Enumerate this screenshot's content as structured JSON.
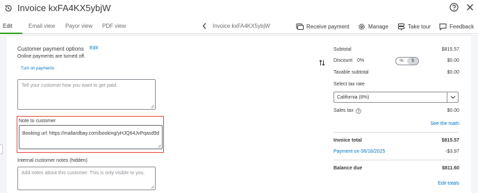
{
  "header": {
    "title": "Invoice kxFA4KX5ybjW"
  },
  "tabs": [
    {
      "label": "Edit"
    },
    {
      "label": "Email view"
    },
    {
      "label": "Payor view"
    },
    {
      "label": "PDF view"
    }
  ],
  "toolbar": {
    "invoice_crumb": "Invoice kxFA4KX5ybjW",
    "receive_payment": "Receive payment",
    "manage": "Manage",
    "take_tour": "Take tour",
    "feedback": "Feedback"
  },
  "payment_options": {
    "title": "Customer payment options",
    "edit": "Edit",
    "status": "Online payments are turned off.",
    "turn_on": "Turn on payments",
    "message_placeholder": "Tell your customer how you want to get paid."
  },
  "note_to_customer": {
    "label": "Note to customer",
    "value": "Booking url: https://mallardbay.com/booking/yHJQ64JvPqasd9d"
  },
  "internal_notes": {
    "label": "Internal customer notes (hidden)",
    "placeholder": "Add notes about this customer. This is only visible to you."
  },
  "totals": {
    "subtotal_label": "Subtotal",
    "subtotal_value": "$815.57",
    "discount_label": "Discount",
    "discount_pct": "0%",
    "discount_toggle": [
      "%",
      "$"
    ],
    "discount_value": "$0.00",
    "taxable_subtotal_label": "Taxable subtotal",
    "taxable_subtotal_value": "$0.00",
    "tax_rate_label": "Select tax rate",
    "tax_rate_selected": "California (8%)",
    "sales_tax_label": "Sales tax",
    "sales_tax_value": "$0.00",
    "see_the_math": "See the math",
    "invoice_total_label": "Invoice total",
    "invoice_total_value": "$815.57",
    "payment_label": "Payment on 06/18/2025",
    "payment_value": "-$3.97",
    "balance_due_label": "Balance due",
    "balance_due_value": "$811.60",
    "edit_totals": "Edit totals"
  },
  "colors": {
    "accent_green": "#2ca01c",
    "link_blue": "#0077c5",
    "highlight_red": "#e5483a"
  }
}
